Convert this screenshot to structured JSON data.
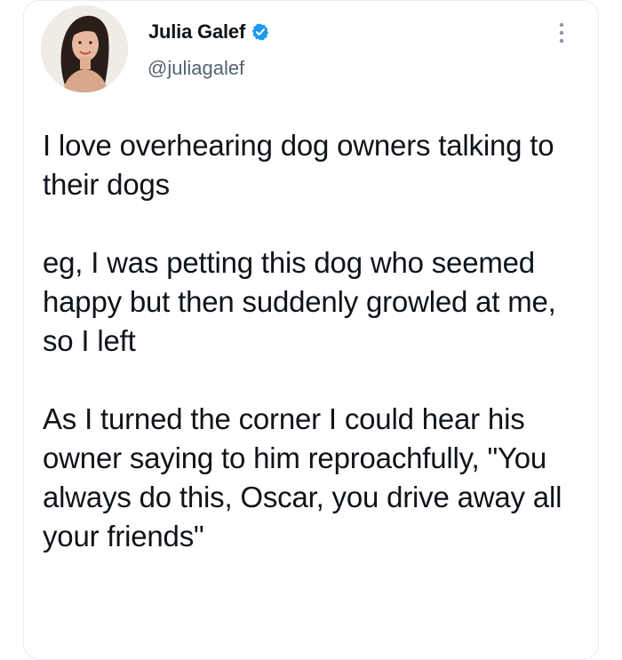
{
  "tweet": {
    "author": {
      "display_name": "Julia Galef",
      "handle": "@juliagalef",
      "verified": true,
      "avatar_icon": "profile-photo"
    },
    "more_icon": "more-vertical-icon",
    "paragraphs": [
      "I love overhearing dog owners talking to their dogs",
      "eg, I was petting this dog who seemed happy but then suddenly growled at me, so I left",
      "As I turned the corner I could hear his owner saying to him reproachfully, \"You always do this, Oscar, you drive away all your friends\""
    ]
  },
  "colors": {
    "text_primary": "#0f1419",
    "text_secondary": "#536471",
    "verified_blue": "#1d9bf0",
    "card_border": "#e6ecf0"
  }
}
